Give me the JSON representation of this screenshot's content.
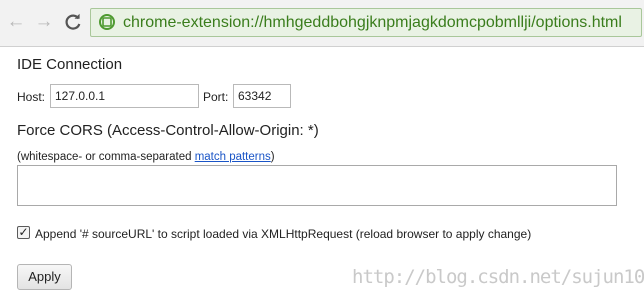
{
  "browser": {
    "back_icon": "←",
    "forward_icon": "→",
    "reload_icon": "C",
    "url": "chrome-extension://hmhgeddbohgjknpmjagkdomcpobmllji/options.html",
    "accent": "#3a7d1c"
  },
  "ide": {
    "heading": "IDE Connection",
    "host_label": "Host:",
    "host_value": "127.0.0.1",
    "port_label": "Port:",
    "port_value": "63342"
  },
  "cors": {
    "heading": "Force CORS (Access-Control-Allow-Origin: *)",
    "hint_prefix": "(whitespace- or comma-separated ",
    "hint_link": "match patterns",
    "hint_suffix": ")",
    "patterns_value": ""
  },
  "options": {
    "append_label": "Append '# sourceURL' to script loaded via XMLHttpRequest (reload browser to apply change)",
    "append_checked": true
  },
  "actions": {
    "apply_label": "Apply"
  },
  "watermark": "http://blog.csdn.net/sujun10"
}
